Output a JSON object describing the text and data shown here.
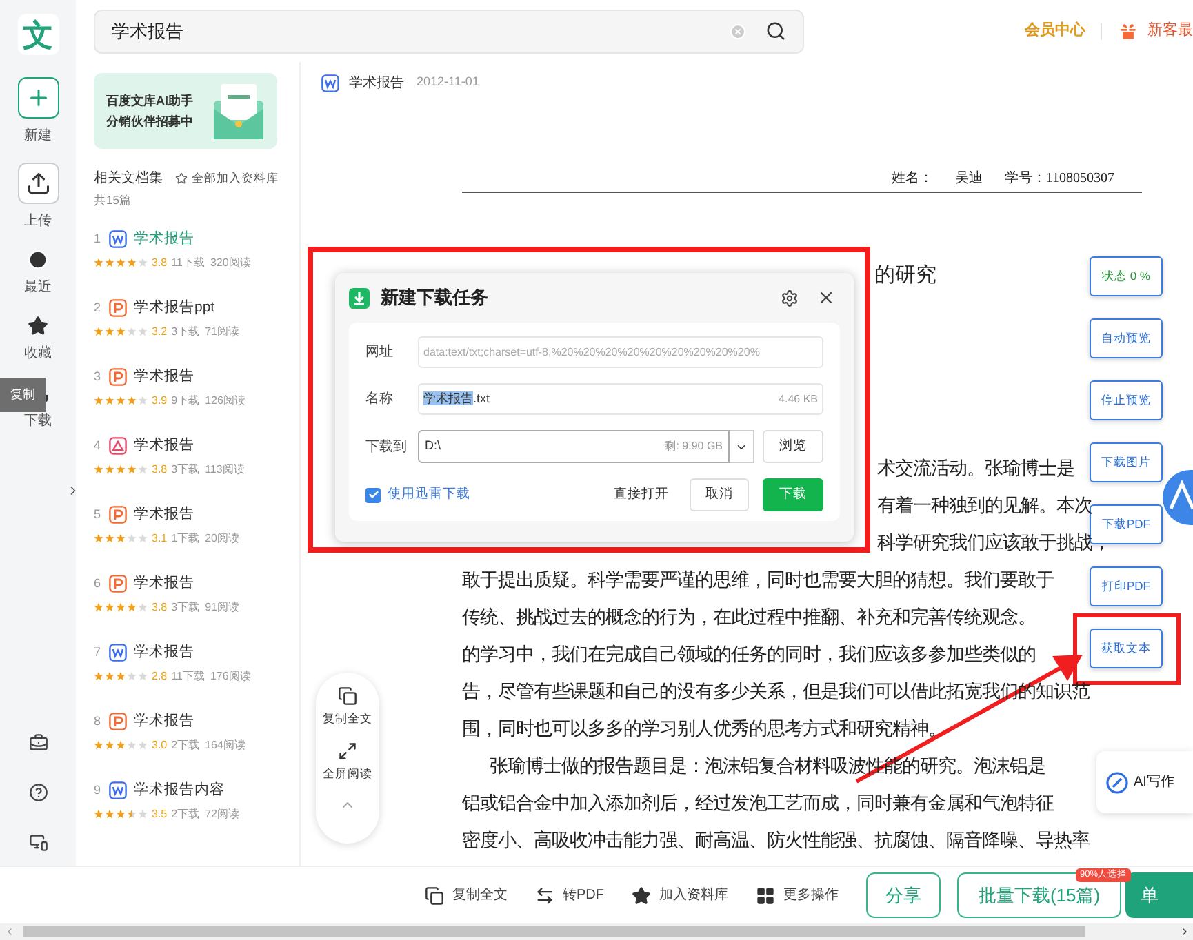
{
  "app_logo": "文",
  "search": {
    "value": "学术报告"
  },
  "header_links": {
    "member_center": "会员中心",
    "new_user": "新客最"
  },
  "rail": {
    "items": [
      {
        "kind": "new",
        "label": "新建"
      },
      {
        "kind": "upload",
        "label": "上传"
      },
      {
        "kind": "recent",
        "label": "最近"
      },
      {
        "kind": "favorite",
        "label": "收藏"
      },
      {
        "kind": "download",
        "label": "下载"
      }
    ],
    "tooltip": "复制"
  },
  "banner": {
    "line_1": "百度文库AI助手",
    "line_2": "分销伙伴**招募中**"
  },
  "collection": {
    "title": "相关文档集",
    "add_all": "全部加入资料库",
    "count": "共15篇"
  },
  "documents": [
    {
      "index": "1",
      "kind": "word",
      "title": "学术报告",
      "selected": true,
      "stars": 4,
      "rating": "3.8",
      "downloads": "11下载",
      "reads": "320阅读"
    },
    {
      "index": "2",
      "kind": "ppt",
      "title": "学术报告ppt",
      "selected": false,
      "stars": 3,
      "rating": "3.2",
      "downloads": "3下载",
      "reads": "71阅读"
    },
    {
      "index": "3",
      "kind": "ppt",
      "title": "学术报告",
      "selected": false,
      "stars": 4,
      "rating": "3.9",
      "downloads": "9下载",
      "reads": "126阅读"
    },
    {
      "index": "4",
      "kind": "pdf",
      "title": "学术报告",
      "selected": false,
      "stars": 4,
      "rating": "3.8",
      "downloads": "3下载",
      "reads": "113阅读"
    },
    {
      "index": "5",
      "kind": "ppt",
      "title": "学术报告",
      "selected": false,
      "stars": 3,
      "rating": "3.1",
      "downloads": "1下载",
      "reads": "20阅读"
    },
    {
      "index": "6",
      "kind": "ppt",
      "title": "学术报告",
      "selected": false,
      "stars": 4,
      "rating": "3.8",
      "downloads": "3下载",
      "reads": "91阅读"
    },
    {
      "index": "7",
      "kind": "word",
      "title": "学术报告",
      "selected": false,
      "stars": 3,
      "rating": "2.8",
      "downloads": "11下载",
      "reads": "176阅读"
    },
    {
      "index": "8",
      "kind": "ppt",
      "title": "学术报告",
      "selected": false,
      "stars": 3,
      "rating": "3.0",
      "downloads": "2下载",
      "reads": "164阅读"
    },
    {
      "index": "9",
      "kind": "word",
      "title": "学术报告内容",
      "selected": false,
      "stars": 3.5,
      "rating": "3.5",
      "downloads": "2下载",
      "reads": "72阅读"
    }
  ],
  "document": {
    "kind": "word",
    "title": "学术报告",
    "date": "2012-11-01",
    "name_label": "姓名：",
    "name": "吴迪",
    "id_label": "学号：1108050307",
    "heading": "的研究",
    "lines": [
      {
        "kind": "partial",
        "text": "术交流活动。张瑜博士是"
      },
      {
        "kind": "partial",
        "text": "有着一种独到的见解。本次"
      },
      {
        "kind": "partial",
        "text": "科学研究我们应该敢于挑战，"
      },
      {
        "kind": "full",
        "text": "敢于提出质疑。科学需要严谨的思维，同时也需要大胆的猜想。我们要敢于"
      },
      {
        "kind": "full",
        "text": "传统、挑战过去的概念的行为，在此过程中推翻、补充和完善传统观念。"
      },
      {
        "kind": "full",
        "text": "的学习中，我们在完成自己领域的任务的同时，我们应该多参加些类似的"
      },
      {
        "kind": "full",
        "text": "告，尽管有些课题和自己的没有多少关系，但是我们可以借此拓宽我们的知识范"
      },
      {
        "kind": "full",
        "text": "围，同时也可以多多的学习别人优秀的思考方式和研究精神。"
      },
      {
        "kind": "indent",
        "text": "张瑜博士做的报告题目是：泡沫铝复合材料吸波性能的研究。泡沫铝是"
      },
      {
        "kind": "full",
        "text": "铝或铝合金中加入添加剂后，经过发泡工艺而成，同时兼有金属和气泡特征"
      },
      {
        "kind": "full",
        "text": "密度小、高吸收冲击能力强、耐高温、防火性能强、抗腐蚀、隔音降噪、导热率"
      }
    ]
  },
  "dialog": {
    "title": "新建下载任务",
    "url_label": "网址",
    "url": "data:text/txt;charset=utf-8,%20%20%20%20%20%20%20%20%20%",
    "name_label": "名称",
    "name_selected": "学术报告",
    "name_rest": ".txt",
    "size": "4.46 KB",
    "path_label": "下载到",
    "path": "D:\\",
    "free_space": "剩: 9.90 GB",
    "browse": "浏览",
    "use_thunder": {
      "label": "使用迅雷下载",
      "checked": true
    },
    "open_directly": "直接打开",
    "cancel": "取消",
    "download": "下载"
  },
  "side_actions": [
    {
      "label": "状态 0 %",
      "kind": "status"
    },
    {
      "label": "自动预览",
      "kind": "action"
    },
    {
      "label": "停止预览",
      "kind": "action"
    },
    {
      "label": "下载图片",
      "kind": "action"
    },
    {
      "label": "下载PDF",
      "kind": "action"
    },
    {
      "label": "打印PDF",
      "kind": "action"
    },
    {
      "label": "获取文本",
      "kind": "highlighted"
    }
  ],
  "ai_write": "AI写作",
  "float_tools": [
    {
      "kind": "copy",
      "label": "复制全文"
    },
    {
      "kind": "fullscreen",
      "label": "全屏阅读"
    }
  ],
  "bottom_tools": [
    {
      "kind": "copy",
      "label": "复制全文"
    },
    {
      "kind": "convert",
      "label": "转PDF"
    },
    {
      "kind": "star",
      "label": "加入资料库"
    },
    {
      "kind": "more",
      "label": "更多操作"
    }
  ],
  "share": "分享",
  "batch_download": {
    "label": "批量下载(15篇)",
    "badge": "90%人选择"
  },
  "single_download": "单"
}
